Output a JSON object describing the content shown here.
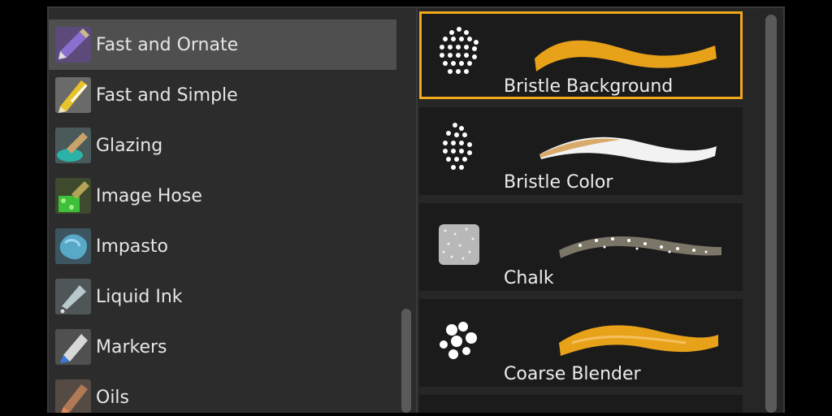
{
  "categories": {
    "items": [
      {
        "label": "Fast and Ornate",
        "icon": "purple-brush-icon",
        "selected": true
      },
      {
        "label": "Fast and Simple",
        "icon": "yellow-pencil-icon",
        "selected": false
      },
      {
        "label": "Glazing",
        "icon": "glazing-brush-icon",
        "selected": false
      },
      {
        "label": "Image Hose",
        "icon": "image-hose-icon",
        "selected": false
      },
      {
        "label": "Impasto",
        "icon": "impasto-icon",
        "selected": false
      },
      {
        "label": "Liquid Ink",
        "icon": "ink-pen-icon",
        "selected": false
      },
      {
        "label": "Markers",
        "icon": "marker-icon",
        "selected": false
      },
      {
        "label": "Oils",
        "icon": "oil-brush-icon",
        "selected": false
      }
    ]
  },
  "variants": {
    "items": [
      {
        "label": "Bristle Background",
        "dab": "bristle-dab-icon",
        "stroke_color": "#e8a21a",
        "selected": true
      },
      {
        "label": "Bristle Color",
        "dab": "bristle-dab-icon",
        "stroke_color": "#f2f2f2",
        "selected": false
      },
      {
        "label": "Chalk",
        "dab": "chalk-dab-icon",
        "stroke_color": "#d8d2c4",
        "selected": false
      },
      {
        "label": "Coarse Blender",
        "dab": "coarse-dab-icon",
        "stroke_color": "#e8a21a",
        "selected": false
      }
    ]
  },
  "colors": {
    "selection_outline": "#f0a81c",
    "panel_bg": "#2c2c2c",
    "selected_row_bg": "#4f4f4f"
  }
}
